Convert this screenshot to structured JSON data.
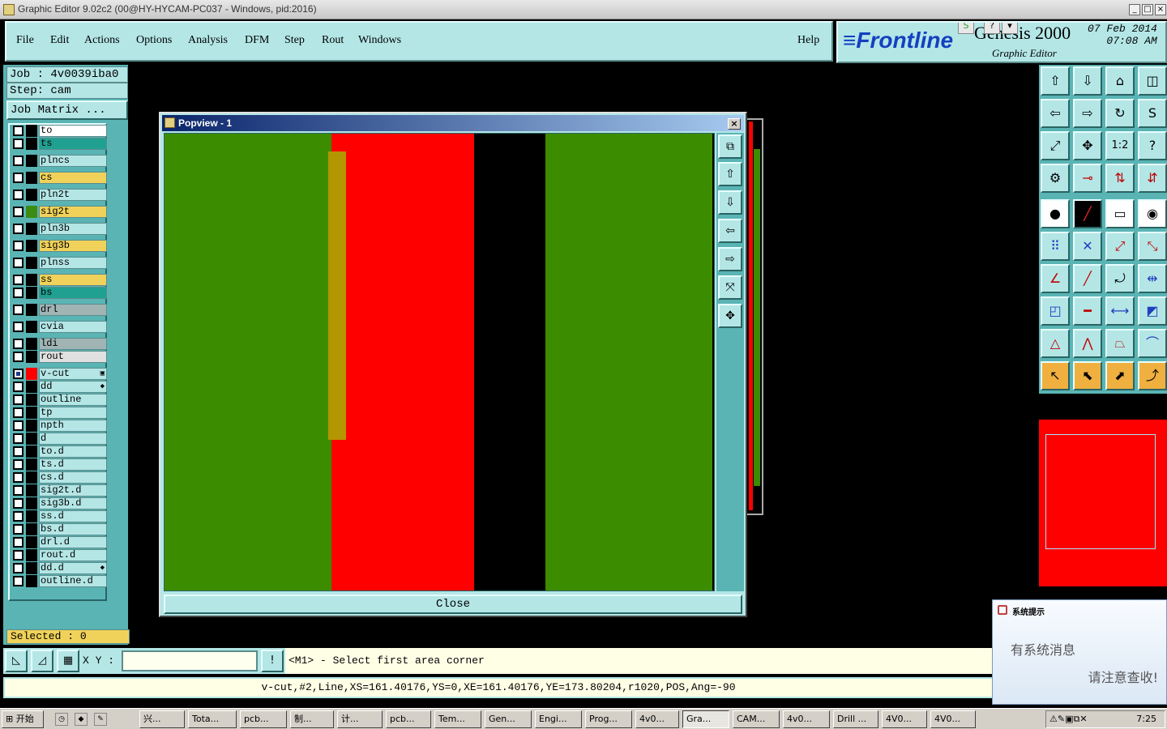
{
  "window": {
    "title": "Graphic Editor 9.02c2 (00@HY-HYCAM-PC037 - Windows, pid:2016)"
  },
  "menu": {
    "items": [
      "File",
      "Edit",
      "Actions",
      "Options",
      "Analysis",
      "DFM",
      "Step",
      "Rout",
      "Windows"
    ],
    "help": "Help"
  },
  "brand": {
    "name": "≡Frontline",
    "product": "Genesis 2000",
    "subtitle": "Graphic Editor",
    "date": "07 Feb 2014",
    "time": "07:08 AM"
  },
  "job": {
    "job": "Job : 4v0039iba0",
    "step": "Step: cam",
    "matrix_button": "Job Matrix ..."
  },
  "layers": [
    {
      "name": "to",
      "color": "#ffffff",
      "swatch": "#000000"
    },
    {
      "name": "ts",
      "color": "#20a090",
      "swatch": "#000000"
    },
    {
      "name": "plncs",
      "color": "#b4e6e6",
      "swatch": "#000000"
    },
    {
      "name": "cs",
      "color": "#f0d25a",
      "swatch": "#000000"
    },
    {
      "name": "pln2t",
      "color": "#b4e6e6",
      "swatch": "#000000"
    },
    {
      "name": "sig2t",
      "color": "#f0d25a",
      "swatch": "#3c8c14"
    },
    {
      "name": "pln3b",
      "color": "#b4e6e6",
      "swatch": "#000000"
    },
    {
      "name": "sig3b",
      "color": "#f0d25a",
      "swatch": "#000000"
    },
    {
      "name": "plnss",
      "color": "#b4e6e6",
      "swatch": "#000000"
    },
    {
      "name": "ss",
      "color": "#f0d25a",
      "swatch": "#000000"
    },
    {
      "name": "bs",
      "color": "#20a090",
      "swatch": "#000000"
    },
    {
      "name": "drl",
      "color": "#a0b4b4",
      "swatch": "#000000"
    },
    {
      "name": "cvia",
      "color": "#b4e6e6",
      "swatch": "#000000"
    },
    {
      "name": "ldi",
      "color": "#a0b4b4",
      "swatch": "#000000"
    },
    {
      "name": "rout",
      "color": "#e0e0e0",
      "swatch": "#000000"
    },
    {
      "name": "v-cut",
      "color": "#b4e6e6",
      "swatch": "#ff0000",
      "mark": "▣"
    },
    {
      "name": "dd",
      "color": "#b4e6e6",
      "swatch": "#000000",
      "mark": "◆"
    },
    {
      "name": "outline",
      "color": "#b4e6e6",
      "swatch": "#000000"
    },
    {
      "name": "tp",
      "color": "#b4e6e6",
      "swatch": "#000000"
    },
    {
      "name": "npth",
      "color": "#b4e6e6",
      "swatch": "#000000"
    },
    {
      "name": "d",
      "color": "#b4e6e6",
      "swatch": "#000000"
    },
    {
      "name": "to.d",
      "color": "#b4e6e6",
      "swatch": "#000000"
    },
    {
      "name": "ts.d",
      "color": "#b4e6e6",
      "swatch": "#000000"
    },
    {
      "name": "cs.d",
      "color": "#b4e6e6",
      "swatch": "#000000"
    },
    {
      "name": "sig2t.d",
      "color": "#b4e6e6",
      "swatch": "#000000"
    },
    {
      "name": "sig3b.d",
      "color": "#b4e6e6",
      "swatch": "#000000"
    },
    {
      "name": "ss.d",
      "color": "#b4e6e6",
      "swatch": "#000000"
    },
    {
      "name": "bs.d",
      "color": "#b4e6e6",
      "swatch": "#000000"
    },
    {
      "name": "drl.d",
      "color": "#b4e6e6",
      "swatch": "#000000"
    },
    {
      "name": "rout.d",
      "color": "#b4e6e6",
      "swatch": "#000000"
    },
    {
      "name": "dd.d",
      "color": "#b4e6e6",
      "swatch": "#000000",
      "mark": "◆"
    },
    {
      "name": "outline.d",
      "color": "#b4e6e6",
      "swatch": "#000000"
    }
  ],
  "selected": "Selected : 0",
  "popview": {
    "title": "Popview - 1",
    "close_label": "Close"
  },
  "command": {
    "xy_label": "X Y :",
    "xy_value": "",
    "prompt": "<M1> - Select first area corner"
  },
  "status": "v-cut,#2,Line,XS=161.40176,YS=0,XE=161.40176,YE=173.80204,r1020,POS,Ang=-90",
  "notification": {
    "title": "系统提示",
    "line1": "有系统消息",
    "line2": "请注意查收!"
  },
  "taskbar": {
    "start": "开始",
    "tasks": [
      "兴...",
      "Tota...",
      "pcb...",
      "制...",
      "计...",
      "pcb...",
      "Tem...",
      "Gen...",
      "Engi...",
      "Prog...",
      "4v0...",
      "Gra...",
      "CAM...",
      "4v0...",
      "Drill ...",
      "4V0...",
      "4V0..."
    ],
    "clock": "7:25"
  },
  "colors": {
    "panel": "#b4e6e6",
    "panel_dark": "#5ab4b4",
    "copper_green": "#3c8c00",
    "vcut_red": "#ff0000",
    "gold": "#b49600"
  }
}
